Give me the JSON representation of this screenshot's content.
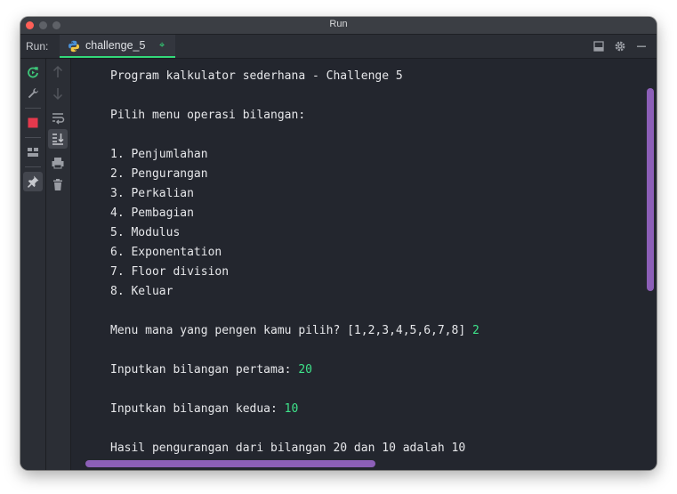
{
  "window": {
    "title": "Run"
  },
  "toolbar": {
    "run_label": "Run:",
    "tab_label": "challenge_5",
    "tab_icon": "python-icon",
    "right_icons": [
      "layout-icon",
      "gear-icon",
      "minimize-icon"
    ]
  },
  "gutter": {
    "left_icons": [
      "rerun-icon",
      "wrench-icon",
      "stop-icon",
      "layout-icon",
      "pin-icon"
    ],
    "right_icons": [
      "arrow-up-icon",
      "arrow-down-icon",
      "soft-wrap-icon",
      "scroll-to-end-icon",
      "print-icon",
      "trash-icon"
    ]
  },
  "console": {
    "lines": [
      "Program kalkulator sederhana - Challenge 5",
      "",
      "Pilih menu operasi bilangan:",
      "",
      "1. Penjumlahan",
      "2. Pengurangan",
      "3. Perkalian",
      "4. Pembagian",
      "5. Modulus",
      "6. Exponentation",
      "7. Floor division",
      "8. Keluar",
      ""
    ],
    "prompt_menu": "Menu mana yang pengen kamu pilih? [1,2,3,4,5,6,7,8] ",
    "input_menu": "2",
    "prompt_first": "Inputkan bilangan pertama: ",
    "input_first": "20",
    "prompt_second": "Inputkan bilangan kedua: ",
    "input_second": "10",
    "result": "Hasil pengurangan dari bilangan 20 dan 10 adalah 10"
  },
  "colors": {
    "background": "#23262e",
    "text": "#e6e7ea",
    "input_text": "#3ee38a",
    "scrollbar": "#8c5fb8",
    "accent": "#33d97a"
  }
}
